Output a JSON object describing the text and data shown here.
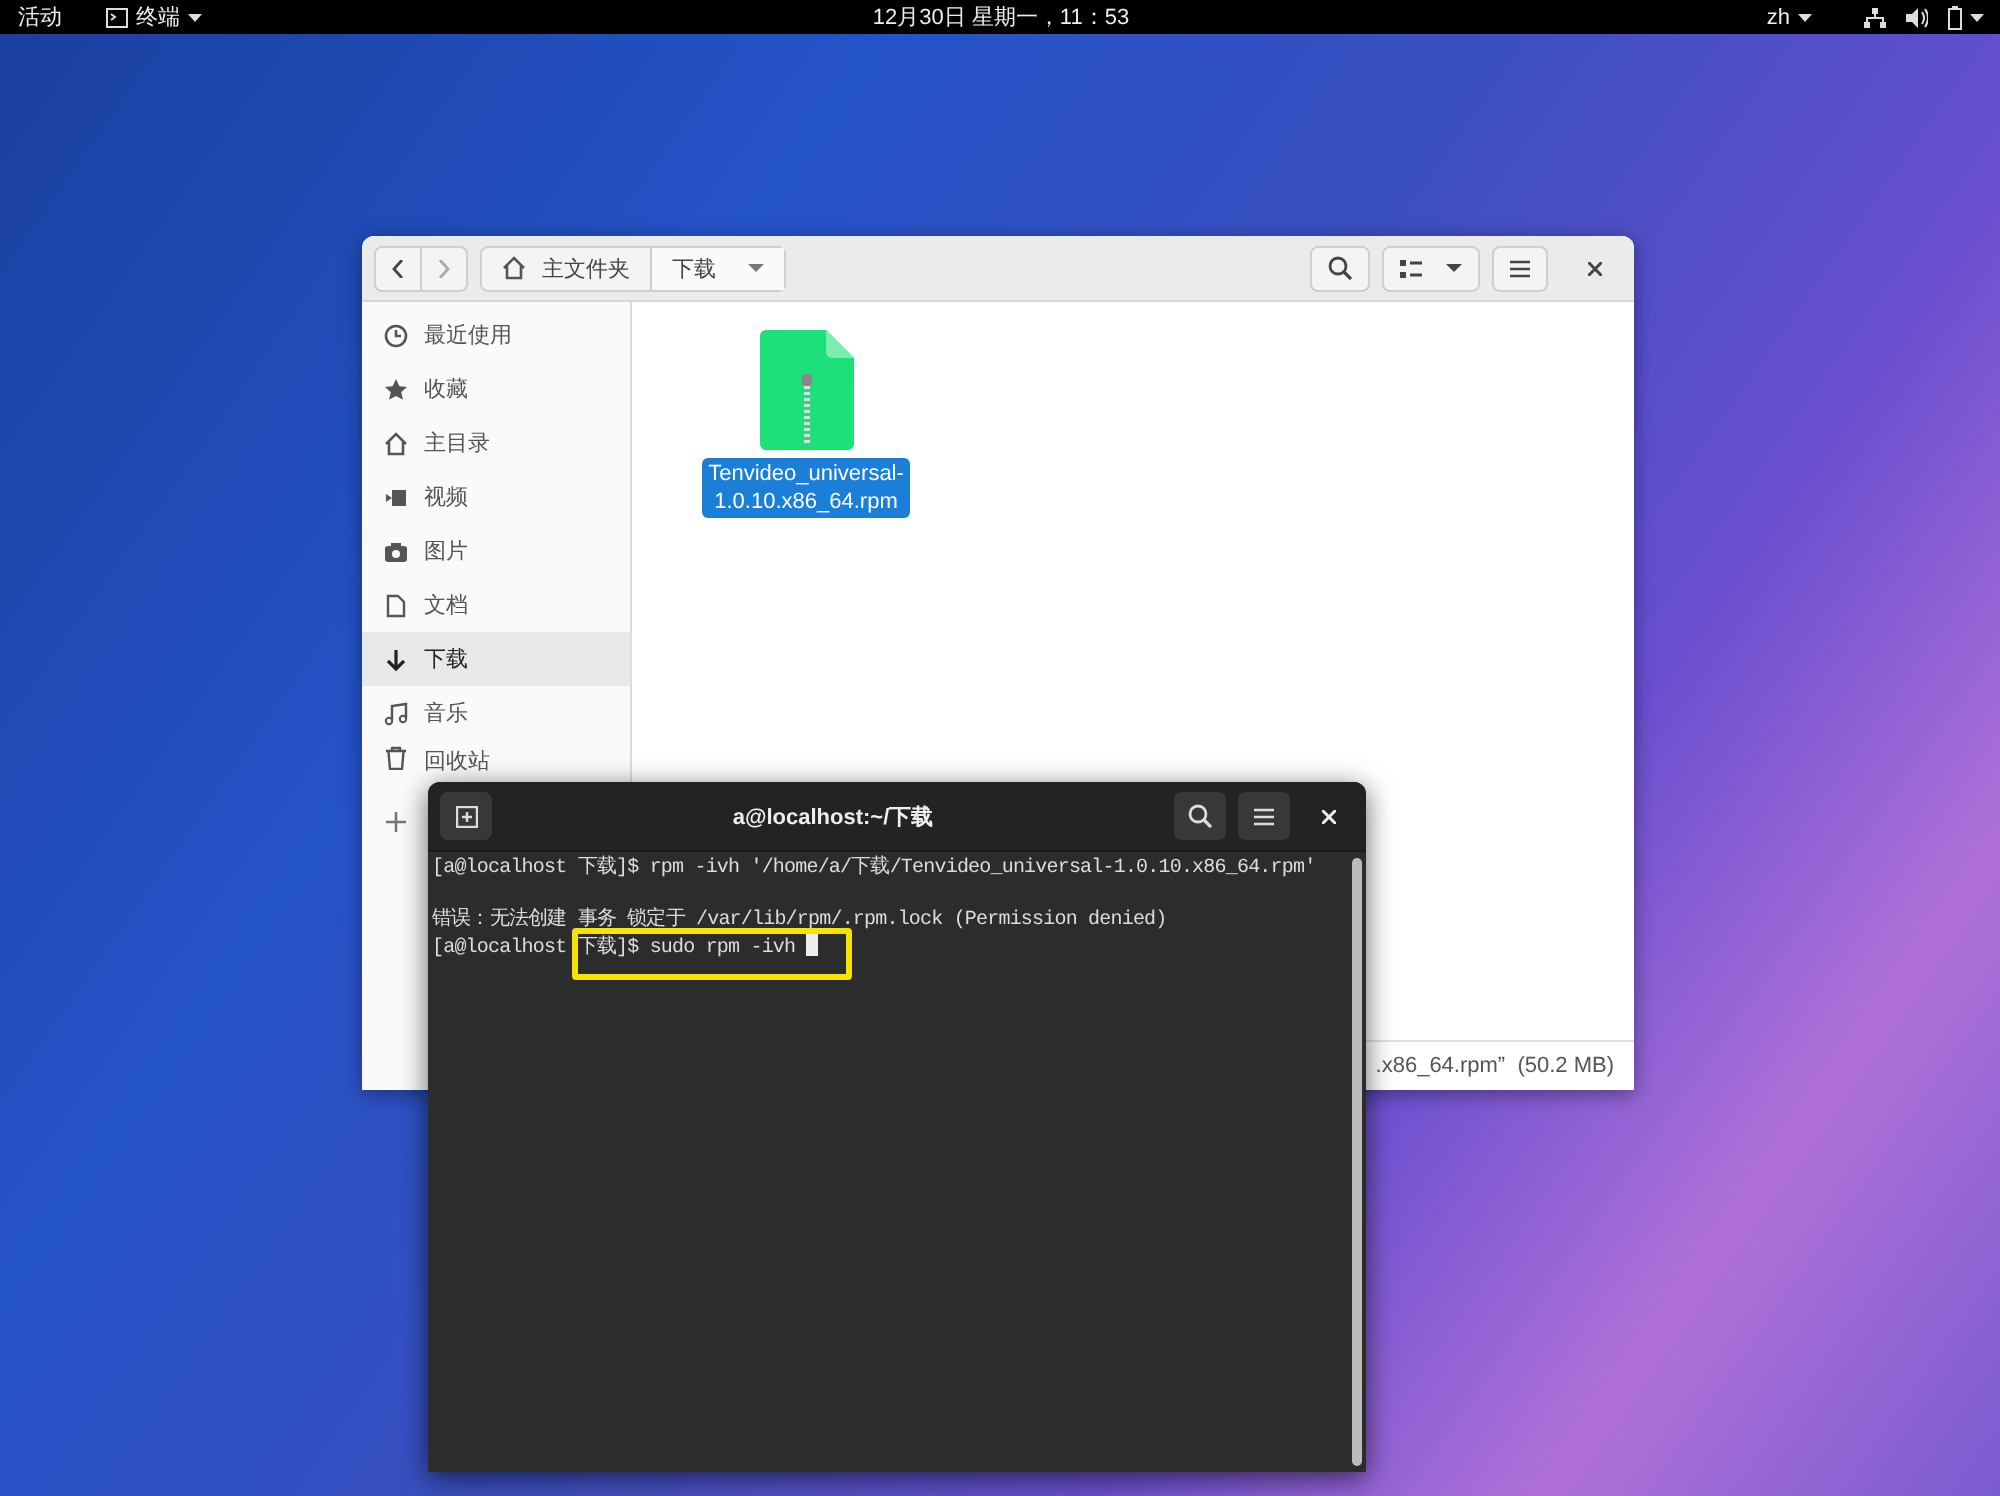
{
  "top_bar": {
    "activities": "活动",
    "app_menu": "终端",
    "clock": "12月30日 星期一，11：53",
    "input_method": "zh"
  },
  "file_manager": {
    "path": [
      {
        "label": "主文件夹",
        "kind": "home",
        "selected": false
      },
      {
        "label": "下载",
        "kind": "folder",
        "selected": true
      }
    ],
    "sidebar": [
      {
        "label": "最近使用",
        "kind": "recent",
        "selected": false
      },
      {
        "label": "收藏",
        "kind": "starred",
        "selected": false
      },
      {
        "label": "主目录",
        "kind": "home",
        "selected": false
      },
      {
        "label": "视频",
        "kind": "videos",
        "selected": false
      },
      {
        "label": "图片",
        "kind": "pictures",
        "selected": false
      },
      {
        "label": "文档",
        "kind": "documents",
        "selected": false
      },
      {
        "label": "下载",
        "kind": "downloads",
        "selected": true
      },
      {
        "label": "音乐",
        "kind": "music",
        "selected": false
      },
      {
        "label": "回收站",
        "kind": "trash",
        "selected": false
      },
      {
        "kind": "other",
        "selected": false
      }
    ],
    "files": [
      {
        "name": "Tenvideo_universal-1.0.10.x86_64.rpm",
        "selected": true
      }
    ],
    "status": ".x86_64.rpm”  (50.2 MB)"
  },
  "terminal": {
    "title": "a@localhost:~/下载",
    "lines": [
      {
        "kind": "text",
        "text": "[a@localhost 下载]$ rpm -ivh '/home/a/下载/Tenvideo_universal-1.0.10.x86_64.rpm'"
      },
      {
        "kind": "blank"
      },
      {
        "kind": "text",
        "text": "错误：无法创建 事务 锁定于 /var/lib/rpm/.rpm.lock (Permission denied)"
      },
      {
        "kind": "text",
        "text": "[a@localhost 下载]$ sudo rpm -ivh "
      }
    ],
    "cursor": true
  }
}
